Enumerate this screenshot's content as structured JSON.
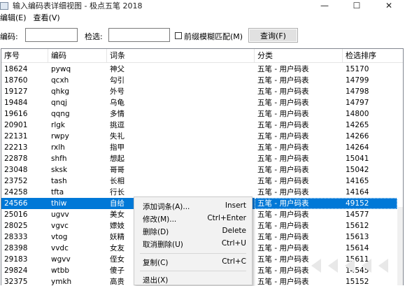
{
  "window": {
    "title": "输入编码表详细视图 - 极点五笔 2018",
    "minimize": "—",
    "maximize": "☐",
    "close": "✕"
  },
  "menu": {
    "items": [
      "编辑(E)",
      "查看(V)"
    ]
  },
  "search": {
    "code_label": "编码:",
    "code_value": "",
    "word_label": "检选:",
    "word_value": "",
    "fuzzy_label": "前缀模糊匹配(M)",
    "fuzzy_checked": false,
    "query_button": "查询(F)"
  },
  "table": {
    "headers": [
      "序号",
      "编码",
      "词条",
      "分类",
      "检选排序"
    ],
    "rows": [
      {
        "id": "18624",
        "code": "pywq",
        "word": "神父",
        "category": "五笔 - 用户码表",
        "order": "15170"
      },
      {
        "id": "18760",
        "code": "qcxh",
        "word": "勾引",
        "category": "五笔 - 用户码表",
        "order": "14799"
      },
      {
        "id": "19127",
        "code": "qhkg",
        "word": "外号",
        "category": "五笔 - 用户码表",
        "order": "14798"
      },
      {
        "id": "19484",
        "code": "qnqj",
        "word": "乌龟",
        "category": "五笔 - 用户码表",
        "order": "14797"
      },
      {
        "id": "19616",
        "code": "qqng",
        "word": "多情",
        "category": "五笔 - 用户码表",
        "order": "14800"
      },
      {
        "id": "20901",
        "code": "rlgk",
        "word": "挑逗",
        "category": "五笔 - 用户码表",
        "order": "14265"
      },
      {
        "id": "22131",
        "code": "rwpy",
        "word": "失礼",
        "category": "五笔 - 用户码表",
        "order": "14266"
      },
      {
        "id": "22213",
        "code": "rxlh",
        "word": "指甲",
        "category": "五笔 - 用户码表",
        "order": "14264"
      },
      {
        "id": "22878",
        "code": "shfh",
        "word": "想起",
        "category": "五笔 - 用户码表",
        "order": "15041"
      },
      {
        "id": "23048",
        "code": "sksk",
        "word": "哥哥",
        "category": "五笔 - 用户码表",
        "order": "15042"
      },
      {
        "id": "23752",
        "code": "tash",
        "word": "长相",
        "category": "五笔 - 用户码表",
        "order": "14165"
      },
      {
        "id": "24258",
        "code": "tfta",
        "word": "行长",
        "category": "五笔 - 用户码表",
        "order": "14164"
      },
      {
        "id": "24566",
        "code": "thiw",
        "word": "自给",
        "category": "五笔 - 用户码表",
        "order": "49152"
      },
      {
        "id": "25016",
        "code": "ugvv",
        "word": "美女",
        "category": "五笔 - 用户码表",
        "order": "14577"
      },
      {
        "id": "28025",
        "code": "vgvc",
        "word": "嫖妓",
        "category": "五笔 - 用户码表",
        "order": "15612"
      },
      {
        "id": "28333",
        "code": "vtog",
        "word": "妖精",
        "category": "五笔 - 用户码表",
        "order": "15613"
      },
      {
        "id": "28398",
        "code": "vvdc",
        "word": "女友",
        "category": "五笔 - 用户码表",
        "order": "15614"
      },
      {
        "id": "29183",
        "code": "wgvv",
        "word": "侄女",
        "category": "五笔 - 用户码表",
        "order": "15611"
      },
      {
        "id": "29824",
        "code": "wtbb",
        "word": "傻子",
        "category": "五笔 - 用户码表",
        "order": "14545"
      },
      {
        "id": "32375",
        "code": "ymkh",
        "word": "高贵",
        "category": "五笔 - 用户码表",
        "order": "15152"
      }
    ],
    "selected_index": 12
  },
  "context_menu": {
    "items": [
      {
        "label": "添加词条(A)...",
        "shortcut": "Insert"
      },
      {
        "label": "修改(M)...",
        "shortcut": "Ctrl+Enter"
      },
      {
        "label": "删除(D)",
        "shortcut": "Delete"
      },
      {
        "label": "取消删除(U)",
        "shortcut": "Ctrl+U"
      },
      {
        "label": "复制(C)",
        "shortcut": "Ctrl+C"
      },
      {
        "label": "退出(X)",
        "shortcut": ""
      }
    ]
  },
  "colors": {
    "selection": "#0078d7",
    "menu_bg": "#f2f2f2"
  }
}
